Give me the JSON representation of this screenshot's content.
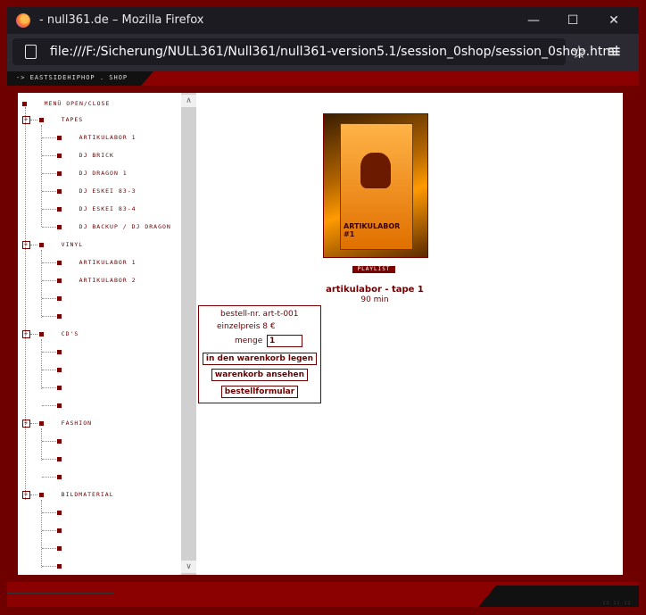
{
  "window": {
    "title": "- null361.de – Mozilla Firefox",
    "minimize": "—",
    "maximize": "☐",
    "close": "✕"
  },
  "urlbar": {
    "url": "file:///F:/Sicherung/NULL361/Null361/null361-version5.1/session_0shop/session_0shop.html",
    "star": "☆",
    "menu": "≡"
  },
  "header": {
    "crumb": "-> EASTSIDEHIPHOP . SHOP"
  },
  "tree": {
    "root": "MENÜ OPEN/CLOSE",
    "tapes": {
      "label": "TAPES",
      "items": [
        "ARTIKULABOR 1",
        "DJ BRICK",
        "DJ DRAGON 1",
        "DJ ESKEI 83-3",
        "DJ ESKEI 83-4",
        "DJ BACKUP / DJ DRAGON"
      ]
    },
    "vinyl": {
      "label": "VINYL",
      "items": [
        "ARTIKULABOR 1",
        "ARTIKULABOR 2",
        "",
        ""
      ]
    },
    "cds": {
      "label": "CD'S",
      "items": [
        "",
        "",
        "",
        ""
      ]
    },
    "fashion": {
      "label": "FASHION",
      "items": [
        "",
        "",
        ""
      ]
    },
    "bildmaterial": {
      "label": "BILDMATERIAL",
      "items": [
        "",
        "",
        "",
        ""
      ]
    },
    "plus": "+"
  },
  "scrollbar": {
    "up": "∧",
    "down": "∨"
  },
  "product": {
    "cover_label": "ARTIKULABOR #1",
    "playlist": "PLAYLIST",
    "title": "artikulabor - tape 1",
    "duration": "90 min"
  },
  "order": {
    "bestell_nr": "bestell-nr.  art-t-001",
    "einzelpreis": "einzelpreis  8 €",
    "menge_label": "menge",
    "menge_value": "1",
    "add_to_cart": "in den warenkorb legen",
    "view_cart": "warenkorb ansehen",
    "order_form": "bestellformular"
  }
}
